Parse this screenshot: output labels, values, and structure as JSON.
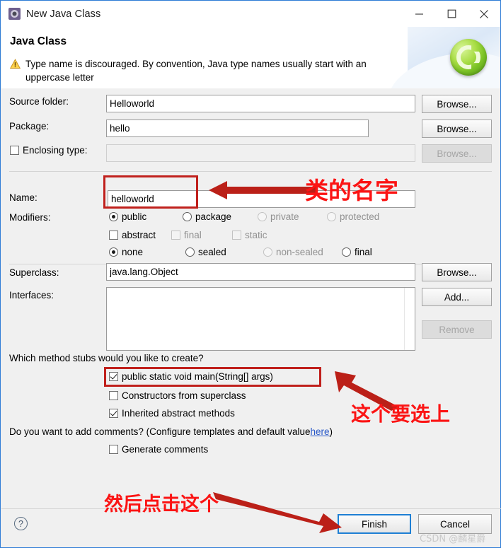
{
  "window": {
    "title": "New Java Class",
    "icon": "java-class-icon",
    "minimize_label": "—",
    "maximize_label": "□",
    "close_label": "✕"
  },
  "banner": {
    "heading": "Java Class",
    "warning_icon": "warning-triangle-icon",
    "warning_text": "Type name is discouraged. By convention, Java type names usually start with an uppercase letter",
    "logo": "eclipse-green-c-logo"
  },
  "form": {
    "source_folder": {
      "label": "Source folder:",
      "value": "Helloworld",
      "button": "Browse..."
    },
    "package": {
      "label": "Package:",
      "value": "hello",
      "button": "Browse..."
    },
    "enclosing_type": {
      "label": "Enclosing type:",
      "checked": false,
      "value": "",
      "button": "Browse...",
      "disabled": true
    },
    "name": {
      "label": "Name:",
      "value": "helloworld"
    },
    "modifiers": {
      "label": "Modifiers:",
      "access": [
        {
          "label": "public",
          "selected": true,
          "disabled": false
        },
        {
          "label": "package",
          "selected": false,
          "disabled": false
        },
        {
          "label": "private",
          "selected": false,
          "disabled": true
        },
        {
          "label": "protected",
          "selected": false,
          "disabled": true
        }
      ],
      "flags": [
        {
          "label": "abstract",
          "checked": false,
          "disabled": false
        },
        {
          "label": "final",
          "checked": false,
          "disabled": true
        },
        {
          "label": "static",
          "checked": false,
          "disabled": true
        }
      ],
      "sealed": [
        {
          "label": "none",
          "selected": true,
          "disabled": false
        },
        {
          "label": "sealed",
          "selected": false,
          "disabled": false
        },
        {
          "label": "non-sealed",
          "selected": false,
          "disabled": true
        },
        {
          "label": "final",
          "selected": false,
          "disabled": false
        }
      ]
    },
    "superclass": {
      "label": "Superclass:",
      "value": "java.lang.Object",
      "button": "Browse..."
    },
    "interfaces": {
      "label": "Interfaces:",
      "items": [],
      "add_button": "Add...",
      "remove_button": "Remove"
    }
  },
  "stubs": {
    "question": "Which method stubs would you like to create?",
    "options": [
      {
        "label": "public static void main(String[] args)",
        "checked": true
      },
      {
        "label": "Constructors from superclass",
        "checked": false
      },
      {
        "label": "Inherited abstract methods",
        "checked": true
      }
    ]
  },
  "comments": {
    "question_prefix": "Do you want to add comments? (Configure templates and default value ",
    "link": "here",
    "question_suffix": ")",
    "option": {
      "label": "Generate comments",
      "checked": false
    }
  },
  "footer": {
    "help_icon": "help-question-icon",
    "finish_button": "Finish",
    "cancel_button": "Cancel"
  },
  "annotations": {
    "name_note": "类的名字",
    "stub_note": "这个要选上",
    "finish_note": "然后点击这个",
    "color": "#fb1414",
    "box_color": "#c0201c",
    "arrow_color": "#bb2018"
  },
  "watermark": "CSDN @麟星爵"
}
